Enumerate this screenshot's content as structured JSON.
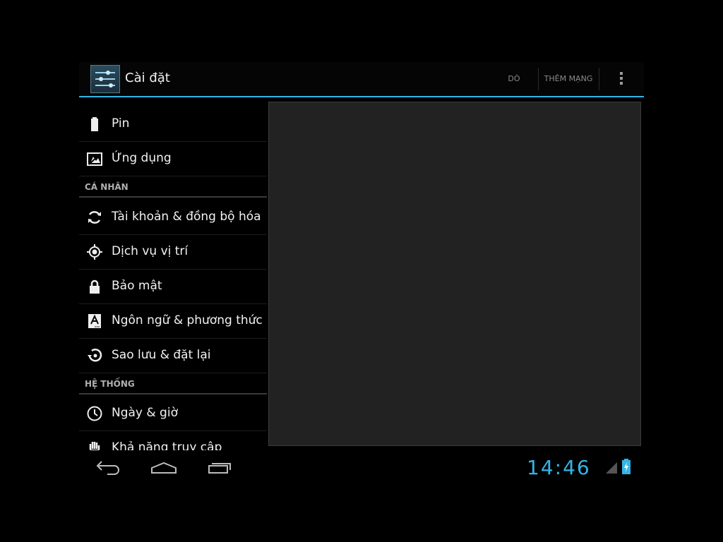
{
  "actionbar": {
    "title": "Cài đặt",
    "app_icon": "settings-sliders-icon",
    "actions": [
      "DÒ",
      "THÊM MẠNG"
    ],
    "overflow_icon": "overflow-menu-icon"
  },
  "list": {
    "items_top": [
      {
        "label": "Pin",
        "icon": "battery-icon"
      },
      {
        "label": "Ứng dụng",
        "icon": "apps-icon"
      }
    ],
    "header_personal": "CÁ NHÂN",
    "items_personal": [
      {
        "label": "Tài khoản & đồng bộ hóa",
        "icon": "sync-icon"
      },
      {
        "label": "Dịch vụ vị trí",
        "icon": "location-icon"
      },
      {
        "label": "Bảo mật",
        "icon": "lock-icon"
      },
      {
        "label": "Ngôn ngữ & phương thức",
        "icon": "language-icon"
      },
      {
        "label": "Sao lưu & đặt lại",
        "icon": "backup-icon"
      }
    ],
    "header_system": "HỆ THỐNG",
    "items_system": [
      {
        "label": "Ngày & giờ",
        "icon": "clock-icon"
      },
      {
        "label": "Khả năng truy cập",
        "icon": "accessibility-hand-icon"
      }
    ]
  },
  "systembar": {
    "time": "14:46",
    "accent": "#33b5e5"
  }
}
